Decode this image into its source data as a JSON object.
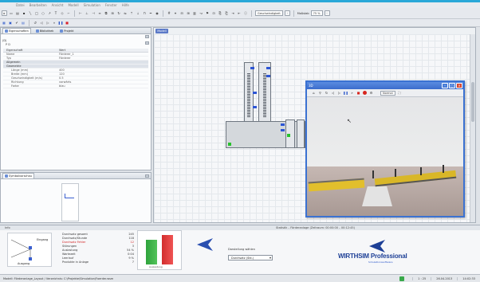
{
  "menu": {
    "items": [
      "Datei",
      "Bearbeiten",
      "Ansicht",
      "Modell",
      "Simulation",
      "Fenster",
      "Hilfe"
    ]
  },
  "toolbar": {
    "speed_select": "Geschwindigkeit",
    "zoom_label": "Maßstab",
    "zoom_value": "75 %"
  },
  "left_panel": {
    "tabs": [
      "Eigenschaften",
      "Bibliothek",
      "Projekt"
    ],
    "section_title": "(D)",
    "search_value": "P D",
    "columns": [
      "Eigenschaft",
      "Wert"
    ],
    "rows": [
      {
        "name": "Name",
        "value": "Förderer_1",
        "type": "item"
      },
      {
        "name": "Typ",
        "value": "Förderer",
        "type": "item"
      },
      {
        "name": "Allgemein",
        "value": "",
        "type": "group"
      },
      {
        "name": "Geometrie",
        "value": "",
        "type": "group"
      },
      {
        "name": "Länge (mm)",
        "value": "400",
        "type": "sub"
      },
      {
        "name": "Breite (mm)",
        "value": "120",
        "type": "sub"
      },
      {
        "name": "Geschwindigkeit (m/s)",
        "value": "0.5",
        "type": "sub"
      },
      {
        "name": "Richtung",
        "value": "vorwärts",
        "type": "sub"
      },
      {
        "name": "Farbe",
        "value": "blau",
        "type": "sub"
      }
    ]
  },
  "left_lower": {
    "title": "Symbolvorschau"
  },
  "canvas": {
    "tab_label": "Modell"
  },
  "viewer": {
    "title": "3D",
    "speed": "Normal"
  },
  "bottom": {
    "header": "Info",
    "caption": "Statistik – Förderanlage (Zeitraum: 00:00:00 – 00:12:45)",
    "diagram_labels": [
      "Eingang",
      "Ausgang"
    ],
    "stats": [
      {
        "label": "Durchsatz gesamt",
        "value": "245",
        "red": false
      },
      {
        "label": "Durchsatz/Stunde",
        "value": "118",
        "red": false
      },
      {
        "label": "Durchsatz Fehler",
        "value": "12",
        "red": true
      },
      {
        "label": "Störungen",
        "value": "3",
        "red": false
      },
      {
        "label": "Auslastung",
        "value": "54 %",
        "red": false
      },
      {
        "label": "Wartezeit",
        "value": "0:04",
        "red": false
      },
      {
        "label": "Leerlauf",
        "value": "9 %",
        "red": false
      },
      {
        "label": "Produkte in Anlage",
        "value": "7",
        "red": false
      }
    ],
    "bar_values": {
      "green": 0.78,
      "red": 0.93
    },
    "bar_label": "Auslastung",
    "dropdown_label": "Darstellung wählen",
    "dropdown_value": "Durchsatz (Stk.)",
    "logo_text": "WIRTHSIM Professional",
    "logo_sub": "Simulationssoftware"
  },
  "status": {
    "path": "Modell: Förderanlage_Layout / Verzeichnis: C:\\Projekte\\Simulation\\Foerder.wsm",
    "cells": [
      "1 : 25",
      "26.04.2013",
      "14:02:33"
    ]
  }
}
